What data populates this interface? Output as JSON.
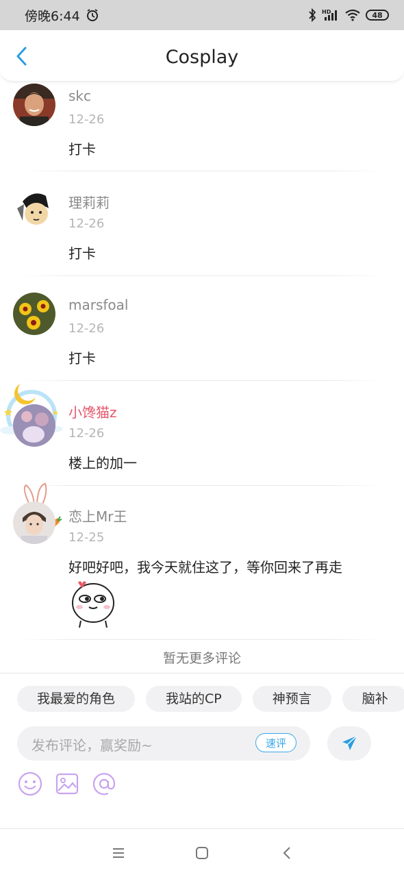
{
  "status_bar": {
    "time": "傍晚6:44",
    "battery": "48",
    "icons": [
      "alarm-icon",
      "bluetooth-icon",
      "signal-icon",
      "wifi-icon",
      "battery-icon"
    ]
  },
  "header": {
    "title": "Cosplay",
    "back_icon": "chevron-left-icon",
    "accent_color": "#2a9de0"
  },
  "comments": [
    {
      "username": "skc",
      "date": "12-26",
      "text": "打卡"
    },
    {
      "username": "理莉莉",
      "date": "12-26",
      "text": "打卡"
    },
    {
      "username": "marsfoal",
      "date": "12-26",
      "text": "打卡"
    },
    {
      "username": "小馋猫z",
      "date": "12-26",
      "text": "楼上的加一",
      "username_color": "#e5566b"
    },
    {
      "username": "恋上Mr王",
      "date": "12-25",
      "text": "好吧好吧，我今天就住这了，等你回来了再走",
      "has_sticker": true
    }
  ],
  "footer_note": "暂无更多评论",
  "composer": {
    "chips": [
      "我最爱的角色",
      "我站的CP",
      "神预言",
      "脑补"
    ],
    "placeholder": "发布评论，赢奖励~",
    "quick_review_label": "速评",
    "send_icon": "send-icon",
    "tool_icons": [
      "emoji-icon",
      "image-icon",
      "at-icon"
    ],
    "tool_color": "#c9a3ee"
  },
  "nav_bar": {
    "icons": [
      "menu-icon",
      "home-icon",
      "back-icon"
    ]
  }
}
